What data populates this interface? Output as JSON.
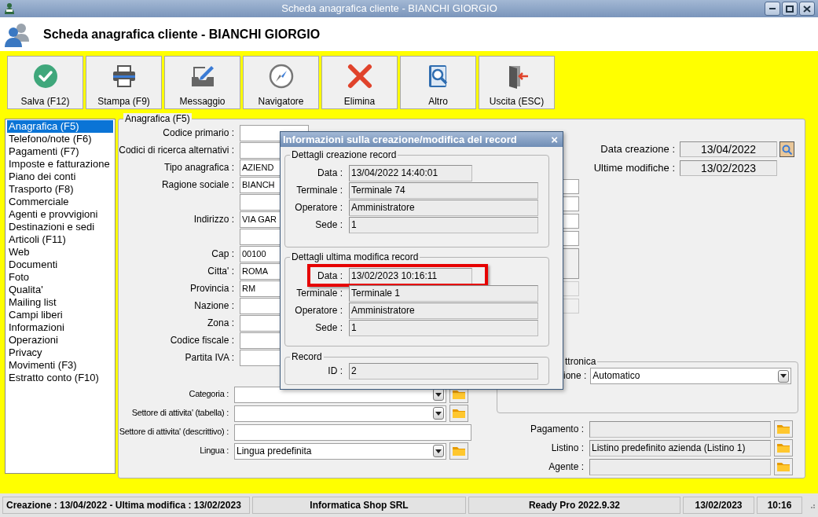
{
  "window": {
    "title": "Scheda anagrafica cliente - BIANCHI GIORGIO"
  },
  "header": {
    "title": "Scheda anagrafica cliente - BIANCHI GIORGIO"
  },
  "toolbar": [
    {
      "label": "Salva (F12)"
    },
    {
      "label": "Stampa (F9)"
    },
    {
      "label": "Messaggio"
    },
    {
      "label": "Navigatore"
    },
    {
      "label": "Elimina"
    },
    {
      "label": "Altro"
    },
    {
      "label": "Uscita (ESC)"
    }
  ],
  "sidebar": {
    "items": [
      {
        "label": "Anagrafica (F5)",
        "selected": true
      },
      {
        "label": "Telefono/note (F6)",
        "selected": false
      },
      {
        "label": "Pagamenti (F7)",
        "selected": false
      },
      {
        "label": "Imposte e fatturazione",
        "selected": false
      },
      {
        "label": "Piano dei conti",
        "selected": false
      },
      {
        "label": "Trasporto (F8)",
        "selected": false
      },
      {
        "label": "Commerciale",
        "selected": false
      },
      {
        "label": "Agenti e provvigioni",
        "selected": false
      },
      {
        "label": "Destinazioni e sedi",
        "selected": false
      },
      {
        "label": "Articoli (F11)",
        "selected": false
      },
      {
        "label": "Web",
        "selected": false
      },
      {
        "label": "Documenti",
        "selected": false
      },
      {
        "label": "Foto",
        "selected": false
      },
      {
        "label": "Qualita'",
        "selected": false
      },
      {
        "label": "Mailing list",
        "selected": false
      },
      {
        "label": "Campi liberi",
        "selected": false
      },
      {
        "label": "Informazioni",
        "selected": false
      },
      {
        "label": "Operazioni",
        "selected": false
      },
      {
        "label": "Privacy",
        "selected": false
      },
      {
        "label": "Movimenti (F3)",
        "selected": false
      },
      {
        "label": "Estratto conto (F10)",
        "selected": false
      }
    ]
  },
  "panel": {
    "legend": "Anagrafica (F5)",
    "fields": [
      {
        "kind": "labeled",
        "label": "Codice primario :"
      },
      {
        "kind": "labeled",
        "label": "Codici di ricerca alternativi :"
      },
      {
        "kind": "labeled",
        "label": "Tipo anagrafica :",
        "value": "AZIEND"
      },
      {
        "kind": "labeled",
        "label": "Ragione sociale :",
        "value": "BIANCH"
      },
      {
        "kind": "extra"
      },
      {
        "kind": "labeled",
        "label": "Indirizzo :",
        "value": "VIA GAR"
      },
      {
        "kind": "extra"
      },
      {
        "kind": "labeled",
        "label": "Cap :",
        "value": "00100"
      },
      {
        "kind": "labeled",
        "label": "Citta' :",
        "value": "ROMA"
      },
      {
        "kind": "labeled",
        "label": "Provincia :",
        "value": "RM"
      },
      {
        "kind": "labeled",
        "label": "Nazione :"
      },
      {
        "kind": "labeled",
        "label": "Zona :"
      },
      {
        "kind": "labeled",
        "label": "Codice fiscale :"
      },
      {
        "kind": "labeled",
        "label": "Partita IVA :"
      }
    ],
    "classification": [
      {
        "label": "Categoria :",
        "kind": "combo"
      },
      {
        "label": "Settore di attivita' (tabella) :",
        "kind": "combo"
      },
      {
        "label": "Settore di attivita' (descrittivo) :",
        "kind": "text"
      },
      {
        "label": "Lingua :",
        "kind": "combo",
        "value": "Lingua predefinita"
      }
    ],
    "dates": [
      {
        "label": "Data creazione :",
        "value": "13/04/2022"
      },
      {
        "label": "Ultime modifiche :",
        "value": "13/02/2023"
      }
    ],
    "e_invoice": {
      "legend": "ttronica",
      "label": "ione :",
      "value": "Automatico"
    },
    "commercial": [
      {
        "label": "Pagamento :"
      },
      {
        "label": "Listino :",
        "value": "Listino predefinito azienda (Listino 1)"
      },
      {
        "label": "Agente :"
      }
    ]
  },
  "dialog": {
    "title": "Informazioni sulla creazione/modifica del record",
    "close": "×",
    "groups": [
      {
        "legend": "Dettagli creazione record",
        "rows": [
          {
            "label": "Data :",
            "value": "13/04/2022 14:40:01",
            "kind": "datetime",
            "highlighted": false
          },
          {
            "label": "Terminale :",
            "value": "Terminale 74",
            "kind": "text",
            "highlighted": false
          },
          {
            "label": "Operatore :",
            "value": "Amministratore",
            "kind": "text",
            "highlighted": false
          },
          {
            "label": "Sede :",
            "value": "1",
            "kind": "text",
            "highlighted": false
          }
        ]
      },
      {
        "legend": "Dettagli ultima modifica record",
        "rows": [
          {
            "label": "Data :",
            "value": "13/02/2023 10:16:11",
            "kind": "datetime",
            "highlighted": true
          },
          {
            "label": "Terminale :",
            "value": "Terminale 1",
            "kind": "text",
            "highlighted": false
          },
          {
            "label": "Operatore :",
            "value": "Amministratore",
            "kind": "text",
            "highlighted": false
          },
          {
            "label": "Sede :",
            "value": "1",
            "kind": "text",
            "highlighted": false
          }
        ]
      },
      {
        "legend": "Record",
        "rows": [
          {
            "label": "ID :",
            "value": "2",
            "kind": "text",
            "highlighted": false
          }
        ]
      }
    ]
  },
  "status_bar": [
    "Creazione : 13/04/2022 - Ultima modifica : 13/02/2023",
    "Informatica Shop SRL",
    "Ready Pro 2022.9.32",
    "13/02/2023",
    "10:16"
  ]
}
